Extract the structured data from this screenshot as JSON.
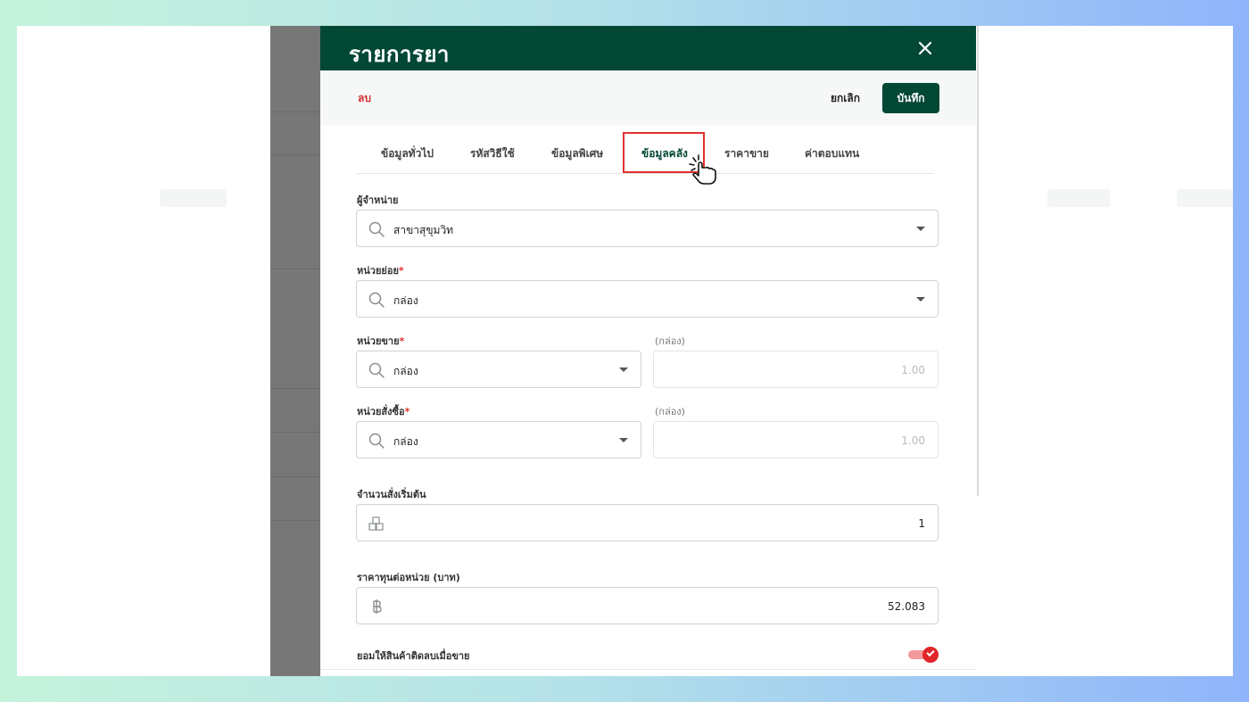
{
  "modal": {
    "title": "รายการยา",
    "close_icon": "close-icon"
  },
  "actions": {
    "delete_label": "ลบ",
    "cancel_label": "ยกเลิก",
    "save_label": "บันทึก"
  },
  "tabs": [
    {
      "label": "ข้อมูลทั่วไป",
      "active": false
    },
    {
      "label": "รหัสวิธีใช้",
      "active": false
    },
    {
      "label": "ข้อมูลพิเศษ",
      "active": false
    },
    {
      "label": "ข้อมูลคลัง",
      "active": true
    },
    {
      "label": "ราคาขาย",
      "active": false
    },
    {
      "label": "ค่าตอบแทน",
      "active": false
    }
  ],
  "form": {
    "distributor": {
      "label": "ผู้จำหน่าย",
      "value": "สาขาสุขุมวิท",
      "icon": "search-icon"
    },
    "sub_unit": {
      "label": "หน่วยย่อย",
      "required_mark": "*",
      "value": "กล่อง",
      "icon": "search-icon"
    },
    "sale_unit": {
      "label": "หน่วยขาย",
      "required_mark": "*",
      "value": "กล่อง",
      "icon": "search-icon",
      "ratio_label": "(กล่อง)",
      "ratio_value": "1.00"
    },
    "order_unit": {
      "label": "หน่วยสั่งซื้อ",
      "required_mark": "*",
      "value": "กล่อง",
      "icon": "search-icon",
      "ratio_label": "(กล่อง)",
      "ratio_value": "1.00"
    },
    "initial_order_qty": {
      "label": "จำนวนสั่งเริ่มต้น",
      "value": "1",
      "icon": "boxes-icon"
    },
    "unit_cost": {
      "label": "ราคาทุนต่อหน่วย (บาท)",
      "value": "52.083",
      "icon": "baht-icon"
    },
    "allow_negative_stock": {
      "label": "ยอมให้สินค้าติดลบเมื่อขาย",
      "enabled": true
    }
  },
  "colors": {
    "brand": "#024835",
    "danger": "#e2312d"
  }
}
